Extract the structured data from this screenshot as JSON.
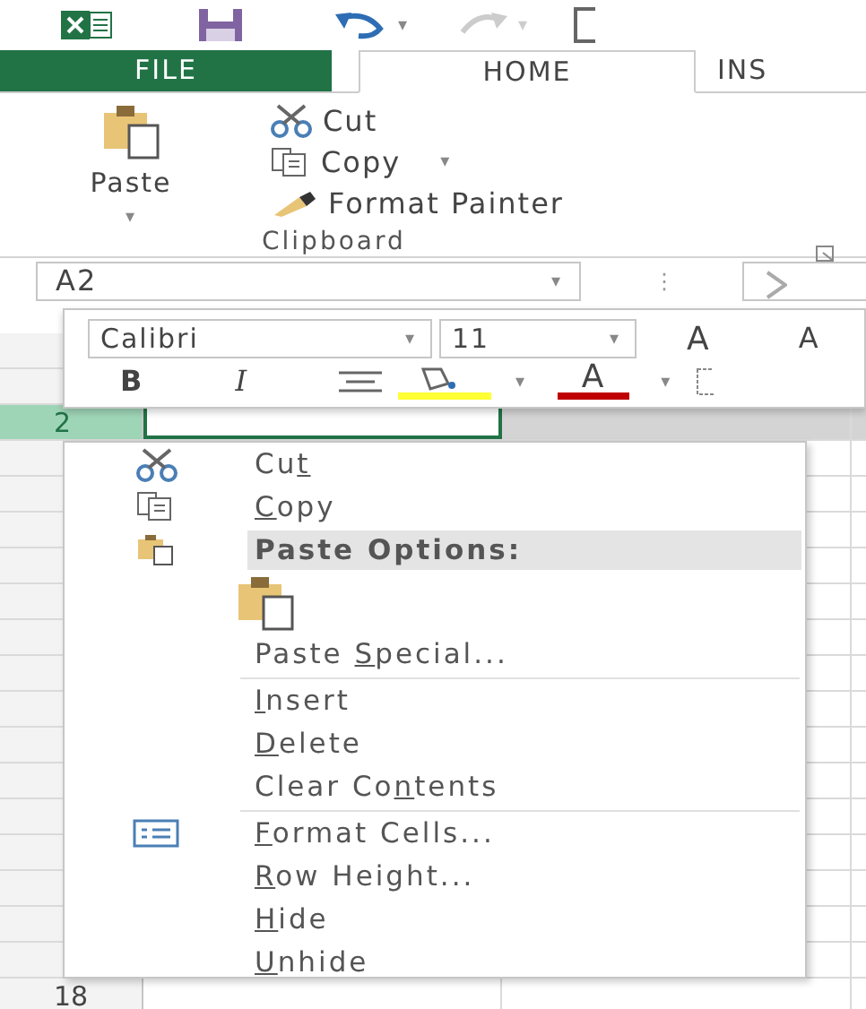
{
  "quick_access": {
    "undo_caret": "▾",
    "redo_caret": "▾"
  },
  "tabs": [
    {
      "label": "FILE",
      "kind": "file",
      "selected": false
    },
    {
      "label": "HOME",
      "kind": "tab",
      "selected": true
    },
    {
      "label": "INS",
      "kind": "tab",
      "selected": false
    }
  ],
  "clipboard": {
    "paste": "Paste",
    "paste_caret": "▾",
    "cut": "Cut",
    "copy": "Copy",
    "copy_caret": "▾",
    "format_painter": "Format Painter",
    "group_label": "Clipboard"
  },
  "name_box": {
    "value": "A2",
    "caret": "▾"
  },
  "formula_bar": {
    "separator": "⋮"
  },
  "mini_toolbar": {
    "font": "Calibri",
    "font_caret": "▾",
    "size": "11",
    "size_caret": "▾",
    "grow": "A",
    "shrink": "A",
    "bold": "B",
    "italic": "I",
    "fill_caret": "▾",
    "font_color": "A",
    "font_color_caret": "▾"
  },
  "rows": [
    {
      "header": "2",
      "selected": true
    },
    {
      "selected": false
    },
    {
      "selected": false
    },
    {
      "selected": false
    },
    {
      "selected": false
    },
    {
      "selected": false
    },
    {
      "selected": false
    },
    {
      "selected": false
    },
    {
      "selected": false
    },
    {
      "selected": false
    },
    {
      "selected": false
    },
    {
      "selected": false
    },
    {
      "selected": false
    },
    {
      "selected": false
    },
    {
      "selected": false
    },
    {
      "selected": false
    },
    {
      "header": "18",
      "selected": false
    }
  ],
  "context_menu": [
    {
      "kind": "item",
      "before": "Cu",
      "key": "t",
      "highlighted": false,
      "separator_before": false
    },
    {
      "kind": "item",
      "key": "C",
      "after": "opy",
      "highlighted": false,
      "separator_before": false
    },
    {
      "kind": "heading",
      "before": "Paste Options:",
      "highlighted": true,
      "separator_before": false
    },
    {
      "kind": "paste-buttons",
      "separator_before": false
    },
    {
      "kind": "item",
      "before": "Paste ",
      "key": "S",
      "after": "pecial...",
      "highlighted": false,
      "separator_before": false
    },
    {
      "kind": "item",
      "key": "I",
      "after": "nsert",
      "highlighted": false,
      "separator_before": true
    },
    {
      "kind": "item",
      "key": "D",
      "after": "elete",
      "highlighted": false,
      "separator_before": false
    },
    {
      "kind": "item",
      "before": "Clear Co",
      "key": "n",
      "after": "tents",
      "highlighted": false,
      "separator_before": false
    },
    {
      "kind": "item",
      "key": "F",
      "after": "ormat Cells...",
      "highlighted": false,
      "separator_before": true
    },
    {
      "kind": "item",
      "key": "R",
      "after": "ow Height...",
      "highlighted": false,
      "separator_before": false
    },
    {
      "kind": "item",
      "key": "H",
      "after": "ide",
      "highlighted": false,
      "separator_before": false
    },
    {
      "kind": "item",
      "key": "U",
      "after": "nhide",
      "highlighted": false,
      "separator_before": false
    }
  ]
}
